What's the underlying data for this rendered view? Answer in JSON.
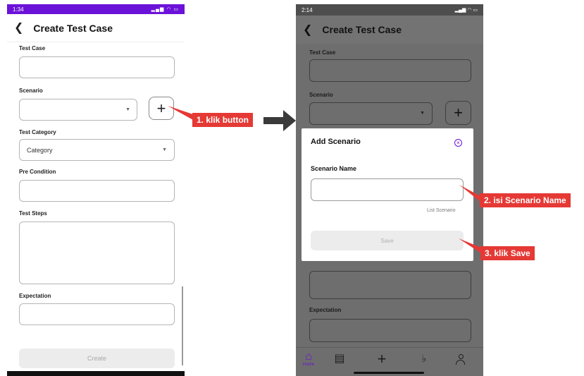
{
  "left": {
    "status": {
      "time": "1:34",
      "icons": "signal wifi battery"
    },
    "appbar": {
      "back": "<",
      "title": "Create Test Case"
    },
    "labels": {
      "test_case": "Test Case",
      "scenario": "Scenario",
      "test_category": "Test Category",
      "pre_condition": "Pre Condition",
      "test_steps": "Test Steps",
      "expectation": "Expectation"
    },
    "category_value": "Category",
    "plus": "+",
    "create_button": "Create"
  },
  "annotations": {
    "step1": "1. klik button",
    "step2": "2. isi Scenario Name",
    "step3": "3. klik Save"
  },
  "right": {
    "status": {
      "time": "2:14",
      "icons": "signal wifi battery"
    },
    "appbar": {
      "back": "<",
      "title": "Create Test Case"
    },
    "labels": {
      "test_case": "Test Case",
      "scenario": "Scenario",
      "expectation": "Expectation"
    },
    "plus": "+",
    "dialog": {
      "title": "Add Scenario",
      "close": "×",
      "field_label": "Scenario Name",
      "list_link": "List Scenario",
      "save_button": "Save"
    },
    "nav": {
      "home_label": "Home",
      "icons": [
        "home-icon",
        "report-icon",
        "plus-icon",
        "bell-icon",
        "user-icon"
      ]
    }
  },
  "colors": {
    "accent": "#6b12d8",
    "callout": "#e53935",
    "overlay": "#6e6e6e"
  }
}
